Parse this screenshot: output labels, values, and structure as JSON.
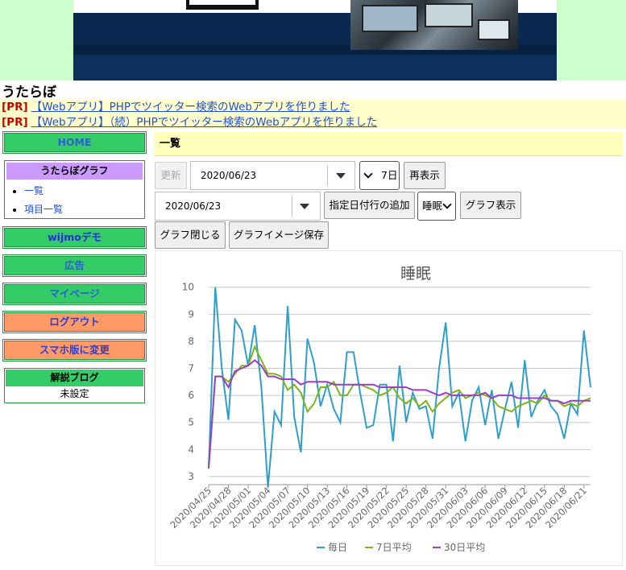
{
  "site": {
    "title": "うたらぼ"
  },
  "pr": [
    {
      "tag": "[PR]",
      "text": "【Webアプリ】PHPでツイッター検索のWebアプリを作りました"
    },
    {
      "tag": "[PR]",
      "text": "【Webアプリ】（続）PHPでツイッター検索のWebアプリを作りました"
    }
  ],
  "sidebar": {
    "home": "HOME",
    "graph_box": {
      "title": "うたらぼグラフ",
      "items": [
        "一覧",
        "項目一覧"
      ]
    },
    "wijmo": "wijmoデモ",
    "ads": "広告",
    "mypage": "マイページ",
    "logout": "ログアウト",
    "smartphone": "スマホ版に変更",
    "blog_box": {
      "title": "解説ブログ",
      "value": "未設定"
    }
  },
  "main": {
    "title": "一覧",
    "toolbar": {
      "refresh": "更新",
      "date1": "2020/06/23",
      "range": "7日",
      "redisplay": "再表示",
      "date2": "2020/06/23",
      "add_row": "指定日付行の追加",
      "item": "睡眠",
      "show_graph": "グラフ表示",
      "close_graph": "グラフ閉じる",
      "save_image": "グラフイメージ保存"
    }
  },
  "colors": {
    "daily": "#2e9fcc",
    "avg7": "#7cb518",
    "avg30": "#9b3fc8",
    "accent_green": "#33cc66",
    "accent_orange": "#ff9966"
  },
  "chart_data": {
    "type": "line",
    "title": "睡眠",
    "ylim": [
      2.7,
      10.2
    ],
    "yticks": [
      3,
      4,
      5,
      6,
      7,
      8,
      9,
      10
    ],
    "x": [
      "2020/04/25",
      "2020/04/26",
      "2020/04/27",
      "2020/04/28",
      "2020/04/29",
      "2020/04/30",
      "2020/05/01",
      "2020/05/02",
      "2020/05/03",
      "2020/05/04",
      "2020/05/05",
      "2020/05/06",
      "2020/05/07",
      "2020/05/08",
      "2020/05/09",
      "2020/05/10",
      "2020/05/11",
      "2020/05/12",
      "2020/05/13",
      "2020/05/14",
      "2020/05/15",
      "2020/05/16",
      "2020/05/17",
      "2020/05/18",
      "2020/05/19",
      "2020/05/20",
      "2020/05/21",
      "2020/05/22",
      "2020/05/23",
      "2020/05/24",
      "2020/05/25",
      "2020/05/26",
      "2020/05/27",
      "2020/05/28",
      "2020/05/29",
      "2020/05/30",
      "2020/05/31",
      "2020/06/01",
      "2020/06/02",
      "2020/06/03",
      "2020/06/04",
      "2020/06/05",
      "2020/06/06",
      "2020/06/07",
      "2020/06/08",
      "2020/06/09",
      "2020/06/10",
      "2020/06/11",
      "2020/06/12",
      "2020/06/13",
      "2020/06/14",
      "2020/06/15",
      "2020/06/16",
      "2020/06/17",
      "2020/06/18",
      "2020/06/19",
      "2020/06/20",
      "2020/06/21",
      "2020/06/22"
    ],
    "tick_labels": [
      "2020/04/25",
      "2020/04/28",
      "2020/05/01",
      "2020/05/04",
      "2020/05/07",
      "2020/05/10",
      "2020/05/13",
      "2020/05/16",
      "2020/05/19",
      "2020/05/22",
      "2020/05/25",
      "2020/05/28",
      "2020/05/31",
      "2020/06/03",
      "2020/06/06",
      "2020/06/09",
      "2020/06/12",
      "2020/06/15",
      "2020/06/18",
      "2020/06/21"
    ],
    "series": [
      {
        "name": "毎日",
        "values": [
          3.3,
          10.0,
          7.0,
          5.1,
          8.8,
          8.4,
          7.1,
          8.6,
          6.3,
          2.6,
          5.4,
          4.9,
          9.3,
          5.2,
          3.9,
          8.1,
          7.2,
          5.6,
          6.4,
          5.5,
          5.0,
          7.6,
          7.6,
          6.1,
          4.8,
          4.9,
          6.4,
          6.4,
          4.3,
          7.1,
          5.0,
          6.1,
          5.5,
          5.6,
          4.4,
          7.0,
          8.7,
          5.6,
          6.1,
          4.3,
          5.8,
          6.3,
          4.9,
          6.2,
          4.4,
          5.5,
          6.5,
          4.8,
          7.3,
          5.2,
          5.8,
          6.2,
          5.6,
          5.3,
          4.4,
          5.7,
          5.3,
          8.4,
          6.3
        ]
      },
      {
        "name": "7日平均",
        "values": [
          3.3,
          6.7,
          6.7,
          6.5,
          6.8,
          7.1,
          7.1,
          7.8,
          7.3,
          6.8,
          6.8,
          6.7,
          6.2,
          6.4,
          6.1,
          5.4,
          5.7,
          6.3,
          6.3,
          6.5,
          6.0,
          6.0,
          6.4,
          6.4,
          6.3,
          6.2,
          6.0,
          6.1,
          6.3,
          5.9,
          5.7,
          5.9,
          5.6,
          5.8,
          5.4,
          5.7,
          5.9,
          6.1,
          6.2,
          5.9,
          6.0,
          6.1,
          6.0,
          5.9,
          5.6,
          5.5,
          5.4,
          5.6,
          5.7,
          5.8,
          5.7,
          6.0,
          5.8,
          5.8,
          5.6,
          5.7,
          5.6,
          5.8,
          5.9
        ]
      },
      {
        "name": "30日平均",
        "values": [
          3.3,
          6.7,
          6.7,
          6.3,
          6.9,
          7.0,
          7.1,
          7.3,
          7.1,
          6.7,
          6.7,
          6.6,
          6.6,
          6.6,
          6.4,
          6.5,
          6.5,
          6.5,
          6.5,
          6.4,
          6.4,
          6.4,
          6.4,
          6.4,
          6.4,
          6.4,
          6.3,
          6.3,
          6.3,
          6.3,
          6.3,
          6.2,
          6.2,
          6.2,
          6.1,
          6.0,
          6.1,
          6.0,
          6.0,
          6.0,
          6.0,
          6.0,
          6.1,
          5.9,
          6.0,
          6.0,
          6.0,
          5.9,
          5.9,
          5.9,
          5.9,
          5.9,
          5.8,
          5.8,
          5.7,
          5.8,
          5.8,
          5.8,
          5.8
        ]
      }
    ],
    "legend_position": "bottom-center"
  }
}
